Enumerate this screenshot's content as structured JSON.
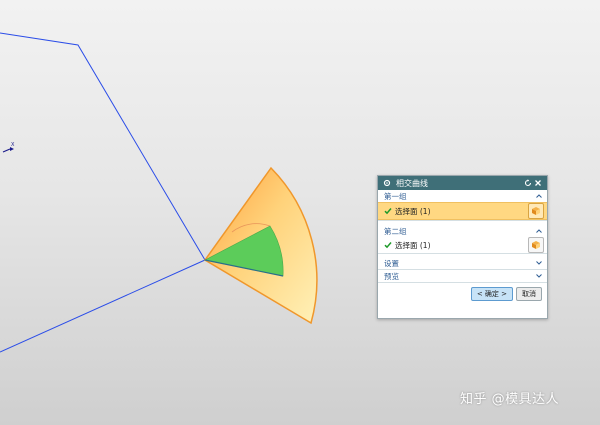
{
  "colors": {
    "sketch_line": "#2b4de8",
    "sector_fill_outer": "#ffc35a",
    "sector_fill_inner": "#fde9a4",
    "sector_edge": "#f0972b",
    "green_face": "#5ccc5a",
    "dialog_title_bg": "#3f6f78",
    "selected_row_bg": "#ffd882"
  },
  "axis": {
    "x_label": "X"
  },
  "dialog": {
    "title": "相交曲线",
    "group1": {
      "title": "第一组",
      "row_label": "选择面 (1)"
    },
    "group2": {
      "title": "第二组",
      "row_label": "选择面 (1)"
    },
    "settings_label": "设置",
    "preview_label": "预览",
    "ok_label": "< 确定 >",
    "cancel_label": "取消"
  },
  "watermark": "知乎 @模具达人"
}
